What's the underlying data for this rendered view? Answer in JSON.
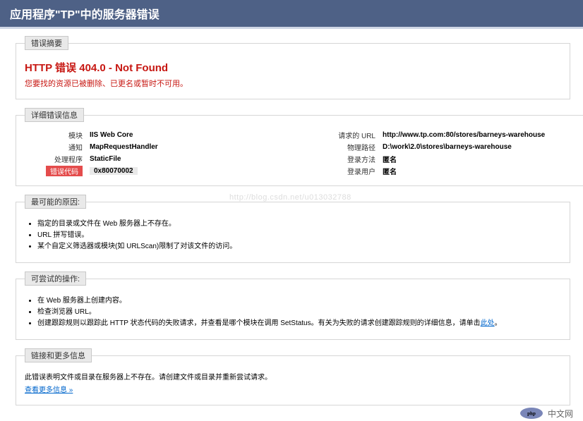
{
  "header": {
    "title": "应用程序\"TP\"中的服务器错误"
  },
  "summary": {
    "legend": "错误摘要",
    "title": "HTTP 错误 404.0 - Not Found",
    "subtitle": "您要找的资源已被删除、已更名或暂时不可用。"
  },
  "detail": {
    "legend": "详细错误信息",
    "left": {
      "module_label": "模块",
      "module": "IIS Web Core",
      "notify_label": "通知",
      "notify": "MapRequestHandler",
      "handler_label": "处理程序",
      "handler": "StaticFile",
      "code_label": "错误代码",
      "code": "0x80070002"
    },
    "right": {
      "url_label": "请求的 URL",
      "url": "http://www.tp.com:80/stores/barneys-warehouse",
      "path_label": "物理路径",
      "path": "D:\\work\\2.0\\stores\\barneys-warehouse",
      "method_label": "登录方法",
      "method": "匿名",
      "user_label": "登录用户",
      "user": "匿名"
    }
  },
  "causes": {
    "legend": "最可能的原因:",
    "items": [
      "指定的目录或文件在 Web 服务器上不存在。",
      "URL 拼写错误。",
      "某个自定义筛选器或模块(如 URLScan)限制了对该文件的访问。"
    ]
  },
  "try": {
    "legend": "可尝试的操作:",
    "items_plain": [
      "在 Web 服务器上创建内容。",
      "检查浏览器 URL。"
    ],
    "item3_pre": "创建跟踪规则以跟踪此 HTTP 状态代码的失败请求，并查看是哪个模块在调用 SetStatus。有关为失败的请求创建跟踪规则的详细信息，请单击",
    "item3_link": "此处",
    "item3_post": "。"
  },
  "links": {
    "legend": "链接和更多信息",
    "text": "此错误表明文件或目录在服务器上不存在。请创建文件或目录并重新尝试请求。",
    "more_label": "查看更多信息 »"
  },
  "watermark": "http://blog.csdn.net/u013032788",
  "brand": "中文网"
}
